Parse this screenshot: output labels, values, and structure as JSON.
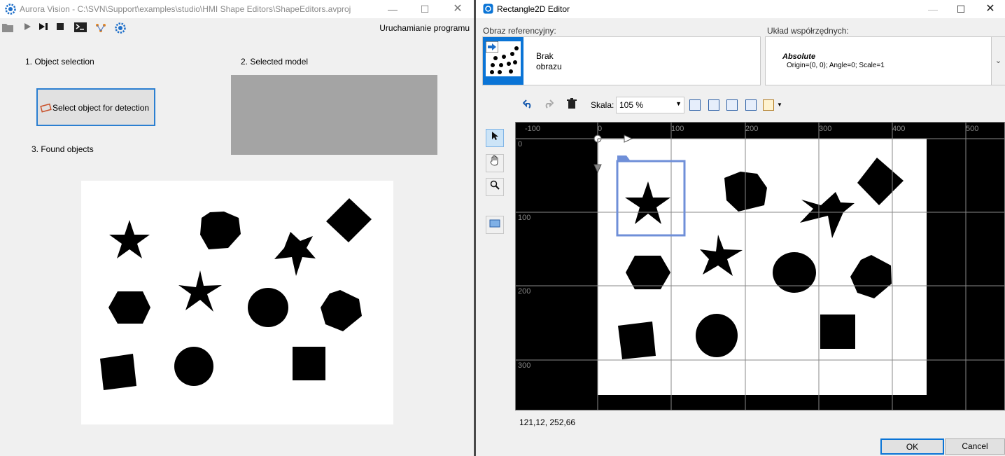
{
  "left_window": {
    "title": "Aurora Vision - C:\\SVN\\Support\\examples\\studio\\HMI Shape Editors\\ShapeEditors.avproj",
    "run_label": "Uruchamianie programu",
    "section1_label": "1. Object selection",
    "section2_label": "2. Selected model",
    "section3_label": "3. Found objects",
    "select_button_label": "Select object for detection",
    "toolbar_icons": [
      "folder-icon",
      "play-icon",
      "step-icon",
      "stop-icon",
      "console-icon",
      "network-icon",
      "settings-icon"
    ]
  },
  "right_window": {
    "title": "Rectangle2D Editor",
    "reference_image_label": "Obraz referencyjny:",
    "reference_image_text": "Brak obrazu",
    "coord_system_label": "Układ współrzędnych:",
    "coord_system_name": "Absolute",
    "coord_system_detail": "Origin=(0, 0); Angle=0; Scale=1",
    "zoom_label": "Skala:",
    "zoom_value": "105 %",
    "ruler_x_labels": [
      "-100",
      "0",
      "100",
      "200",
      "300",
      "400",
      "500"
    ],
    "ruler_y_labels": [
      "0",
      "100",
      "200",
      "300"
    ],
    "cursor_position": "121,12, 252,66",
    "ok_label": "OK",
    "cancel_label": "Cancel",
    "accent_color": "#0a74d6",
    "selection_color": "#6f8fd8"
  }
}
